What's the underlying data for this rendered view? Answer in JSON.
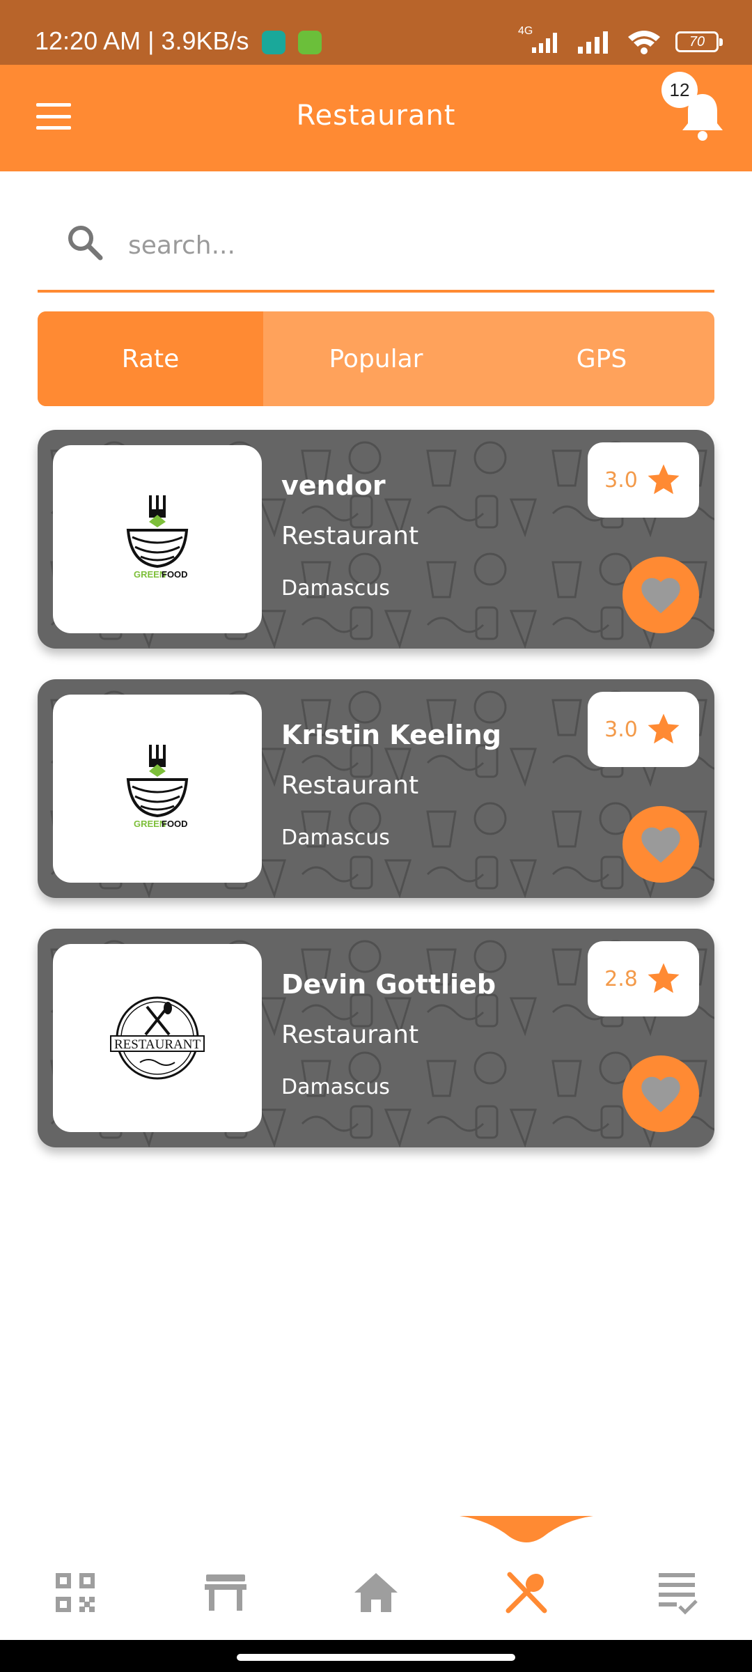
{
  "status_bar": {
    "time_speed": "12:20 AM | 3.9KB/s",
    "network_label": "4G",
    "battery": "70"
  },
  "app_bar": {
    "title": "Restaurant",
    "notification_count": "12"
  },
  "search": {
    "placeholder": "search..."
  },
  "tabs": [
    {
      "label": "Rate",
      "active": true
    },
    {
      "label": "Popular",
      "active": false
    },
    {
      "label": "GPS",
      "active": false
    }
  ],
  "restaurants": [
    {
      "name": "vendor",
      "type": "Restaurant",
      "city": "Damascus",
      "rating": "3.0",
      "logo": "greenfood-logo"
    },
    {
      "name": "Kristin Keeling",
      "type": "Restaurant",
      "city": "Damascus",
      "rating": "3.0",
      "logo": "greenfood-logo"
    },
    {
      "name": "Devin Gottlieb",
      "type": "Restaurant",
      "city": "Damascus",
      "rating": "2.8",
      "logo": "restaurant-emblem-logo"
    }
  ],
  "logo_text": {
    "greenfood_green": "GREEN",
    "greenfood_black": "FOOD",
    "emblem": "RESTAURANT"
  },
  "bottom_nav": [
    {
      "icon": "qr-code-icon",
      "active": false
    },
    {
      "icon": "table-icon",
      "active": false
    },
    {
      "icon": "home-icon",
      "active": false
    },
    {
      "icon": "restaurant-icon",
      "active": true
    },
    {
      "icon": "orders-list-icon",
      "active": false
    }
  ],
  "colors": {
    "accent": "#ff8a33",
    "accent_light": "#ffa25b",
    "status_bar": "#b8642a",
    "card": "#656565",
    "rating_text": "#f39a4a",
    "nav_inactive": "#9e9e9e"
  }
}
